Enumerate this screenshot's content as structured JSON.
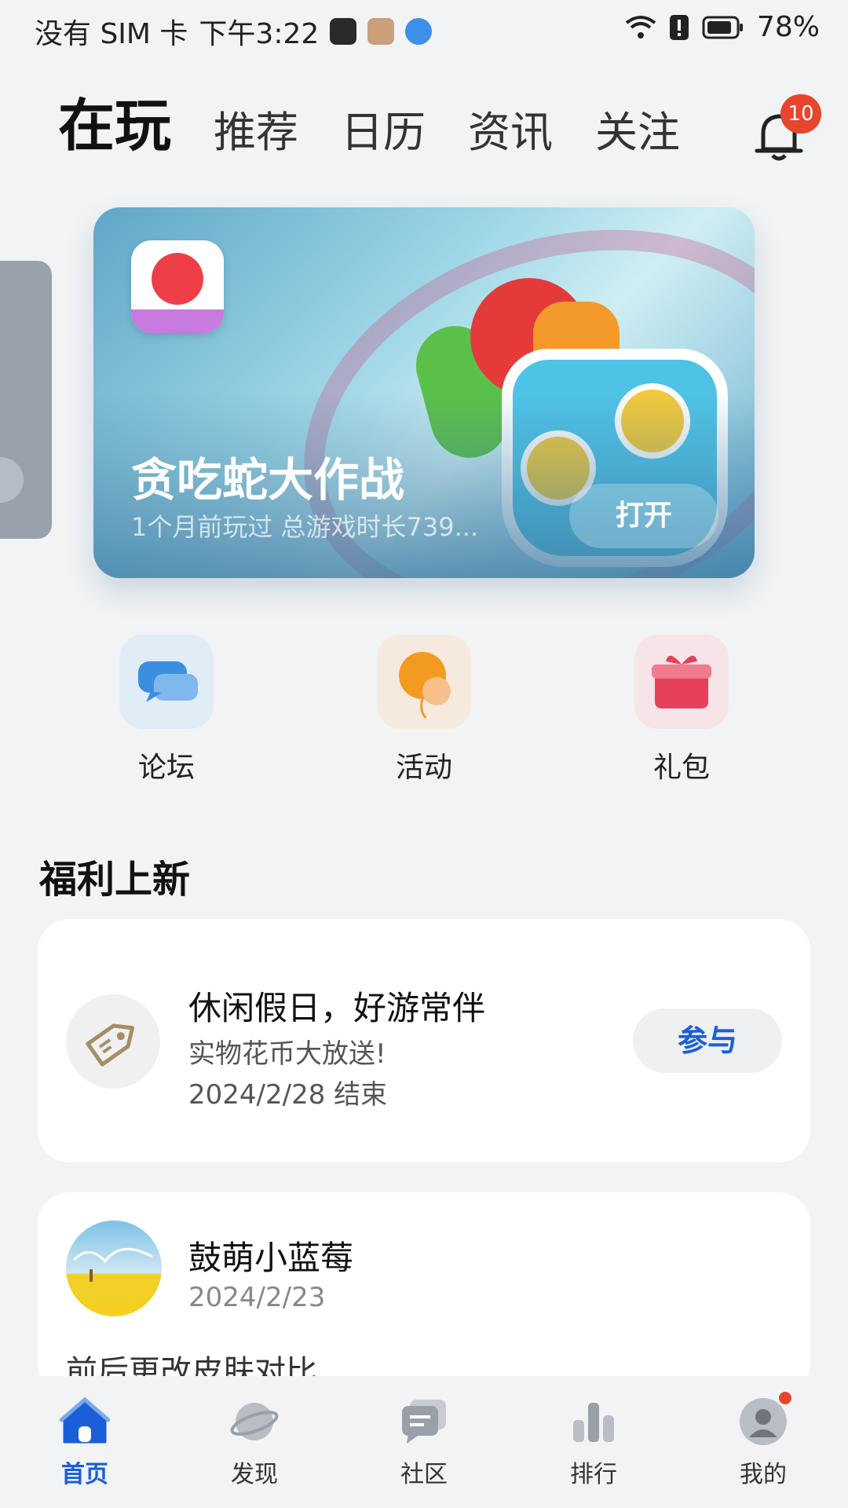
{
  "status_bar": {
    "carrier": "没有 SIM 卡",
    "time": "下午3:22",
    "battery": "78%"
  },
  "header": {
    "tabs": [
      {
        "label": "在玩",
        "active": true
      },
      {
        "label": "推荐"
      },
      {
        "label": "日历"
      },
      {
        "label": "资讯"
      },
      {
        "label": "关注"
      }
    ],
    "notification_count": "10"
  },
  "banner": {
    "game_title": "贪吃蛇大作战",
    "subtitle": "1个月前玩过  总游戏时长739...",
    "open_label": "打开"
  },
  "quick_actions": [
    {
      "label": "论坛",
      "icon": "chat-bubble-icon",
      "color": "#3b8fe0"
    },
    {
      "label": "活动",
      "icon": "balloon-icon",
      "color": "#f39a20"
    },
    {
      "label": "礼包",
      "icon": "gift-icon",
      "color": "#e6405a"
    }
  ],
  "welfare": {
    "section_title": "福利上新",
    "title": "休闲假日，好游常伴",
    "desc": "实物花币大放送!",
    "end": "2024/2/28 结束",
    "join_label": "参与"
  },
  "post": {
    "author": "鼓萌小蓝莓",
    "date": "2024/2/23",
    "text": "前后更改皮肤对比"
  },
  "bottom_nav": [
    {
      "label": "首页",
      "icon": "home-icon",
      "active": true
    },
    {
      "label": "发现",
      "icon": "planet-icon"
    },
    {
      "label": "社区",
      "icon": "community-icon"
    },
    {
      "label": "排行",
      "icon": "ranking-icon"
    },
    {
      "label": "我的",
      "icon": "profile-icon",
      "dot": true
    }
  ],
  "colors": {
    "accent": "#1a5fd8",
    "badge": "#e8442e",
    "background": "#f1f3f5"
  }
}
